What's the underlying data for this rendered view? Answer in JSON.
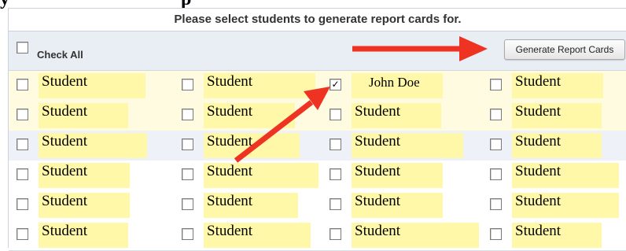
{
  "heading": {
    "text_left": "y",
    "text_right": "p"
  },
  "instructions": "Please select students to generate report cards for.",
  "check_all_label": "Check All",
  "generate_button_label": "Generate Report Cards",
  "students": {
    "rows": [
      [
        {
          "name": "Student",
          "checked": false
        },
        {
          "name": "Student",
          "checked": false
        },
        {
          "name": "John Doe",
          "checked": true
        },
        {
          "name": "Student",
          "checked": false
        }
      ],
      [
        {
          "name": "Student",
          "checked": false
        },
        {
          "name": "Student",
          "checked": false
        },
        {
          "name": "Student",
          "checked": false
        },
        {
          "name": "Student",
          "checked": false
        }
      ],
      [
        {
          "name": "Student",
          "checked": false
        },
        {
          "name": "Student",
          "checked": false
        },
        {
          "name": "Student",
          "checked": false
        },
        {
          "name": "Student",
          "checked": false
        }
      ],
      [
        {
          "name": "Student",
          "checked": false
        },
        {
          "name": "Student",
          "checked": false
        },
        {
          "name": "Student",
          "checked": false
        },
        {
          "name": "Student",
          "checked": false
        }
      ],
      [
        {
          "name": "Student",
          "checked": false
        },
        {
          "name": "Student",
          "checked": false
        },
        {
          "name": "Student",
          "checked": false
        },
        {
          "name": "Student",
          "checked": false
        }
      ],
      [
        {
          "name": "Student",
          "checked": false
        },
        {
          "name": "Student",
          "checked": false
        },
        {
          "name": "Student",
          "checked": false
        },
        {
          "name": "Student",
          "checked": false
        }
      ]
    ]
  },
  "colors": {
    "highlight": "#fff8a8",
    "arrow": "#ee3322",
    "header_bg": "#e9eef5"
  },
  "icons": [
    "checkbox-icon",
    "arrow-annotation"
  ]
}
